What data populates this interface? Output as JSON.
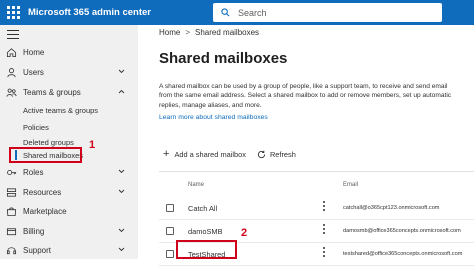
{
  "header": {
    "app_title": "Microsoft 365 admin center",
    "search_placeholder": "Search",
    "bar_color": "#0f6cbd"
  },
  "sidebar": {
    "items": [
      {
        "label": "Home",
        "icon": "home-icon"
      },
      {
        "label": "Users",
        "icon": "user-icon",
        "chevron": "down"
      },
      {
        "label": "Teams & groups",
        "icon": "teams-icon",
        "chevron": "up"
      },
      {
        "label": "Roles",
        "icon": "key-icon",
        "chevron": "down"
      },
      {
        "label": "Resources",
        "icon": "resources-icon",
        "chevron": "down"
      },
      {
        "label": "Marketplace",
        "icon": "marketplace-icon"
      },
      {
        "label": "Billing",
        "icon": "billing-icon",
        "chevron": "down"
      },
      {
        "label": "Support",
        "icon": "support-icon",
        "chevron": "down"
      }
    ],
    "subitems": [
      {
        "label": "Active teams & groups"
      },
      {
        "label": "Policies"
      },
      {
        "label": "Deleted groups"
      },
      {
        "label": "Shared mailboxes",
        "selected": true
      }
    ]
  },
  "annotations": {
    "marker_1": "1",
    "marker_2": "2",
    "color": "#d0021b"
  },
  "breadcrumb": {
    "home": "Home",
    "current": "Shared mailboxes"
  },
  "main": {
    "title": "Shared mailboxes",
    "description_lines": [
      "A shared mailbox can be used by a group of people, like a support team, to receive and send email",
      "from the same email address. Select a shared mailbox to add or remove members, set up automatic",
      "replies, manage aliases, and more."
    ],
    "learn_more": "Learn more about shared mailboxes",
    "toolbar": {
      "add_label": "Add a shared mailbox",
      "refresh_label": "Refresh"
    },
    "columns": {
      "name": "Name",
      "email": "Email"
    },
    "rows": [
      {
        "name": "Catch All",
        "email": "catchall@o365cpt123.onmicrosoft.com"
      },
      {
        "name": "damoSMB",
        "email": "damosmb@office365concepts.onmicrosoft.com"
      },
      {
        "name": "TestShared",
        "email": "testshared@office365concepts.onmicrosoft.com"
      }
    ]
  }
}
